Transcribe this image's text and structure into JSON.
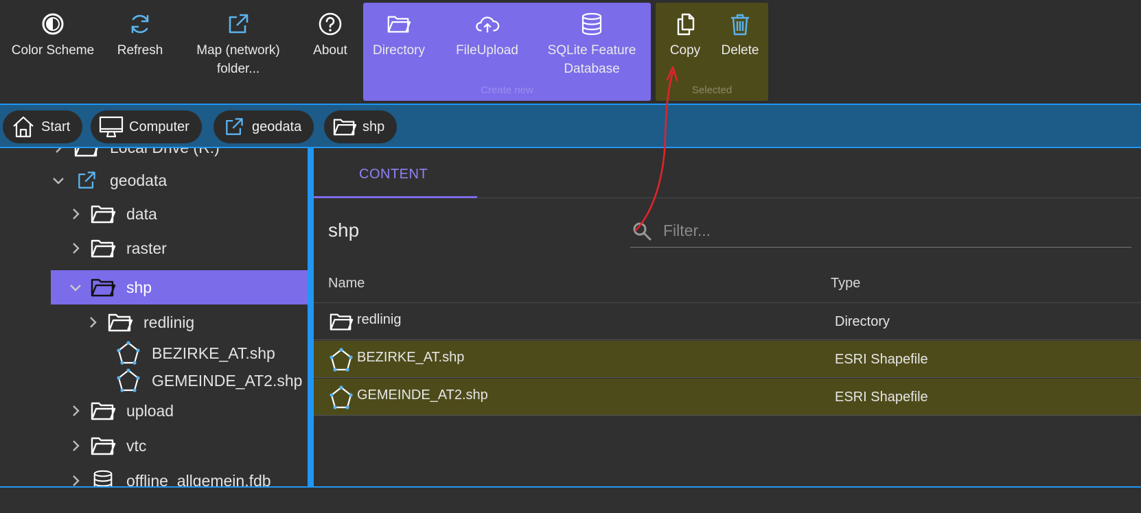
{
  "toolbar": {
    "buttons": [
      {
        "label": "Color Scheme",
        "icon": "contrast-icon"
      },
      {
        "label": "Refresh",
        "icon": "refresh-icon"
      },
      {
        "label": "Map (network) folder...",
        "icon": "external-link-icon"
      },
      {
        "label": "About",
        "icon": "help-icon"
      }
    ],
    "create_group": {
      "title": "Create new",
      "buttons": [
        {
          "label": "Directory",
          "icon": "folder-open-icon"
        },
        {
          "label": "FileUpload",
          "icon": "cloud-upload-icon"
        },
        {
          "label": "SQLite Feature Database",
          "icon": "database-icon"
        }
      ]
    },
    "selected_group": {
      "title": "Selected",
      "buttons": [
        {
          "label": "Copy",
          "icon": "copy-icon"
        },
        {
          "label": "Delete",
          "icon": "trash-icon"
        }
      ]
    }
  },
  "breadcrumbs": [
    {
      "label": "Start",
      "icon": "home-icon"
    },
    {
      "label": "Computer",
      "icon": "monitor-icon"
    },
    {
      "label": "geodata",
      "icon": "external-link-icon"
    },
    {
      "label": "shp",
      "icon": "folder-open-icon"
    }
  ],
  "tree": [
    {
      "label": "Local Drive (R:)",
      "icon": "folder-open-icon",
      "expanded": false
    },
    {
      "label": "geodata",
      "icon": "external-link-icon",
      "expanded": true
    },
    {
      "label": "data",
      "icon": "folder-open-icon",
      "expanded": false
    },
    {
      "label": "raster",
      "icon": "folder-open-icon",
      "expanded": false
    },
    {
      "label": "shp",
      "icon": "folder-open-icon",
      "expanded": true,
      "selected": true
    },
    {
      "label": "redlinig",
      "icon": "folder-open-icon",
      "expanded": false
    },
    {
      "label": "BEZIRKE_AT.shp",
      "icon": "polygon-icon"
    },
    {
      "label": "GEMEINDE_AT2.shp",
      "icon": "polygon-icon"
    },
    {
      "label": "upload",
      "icon": "folder-open-icon",
      "expanded": false
    },
    {
      "label": "vtc",
      "icon": "folder-open-icon",
      "expanded": false
    },
    {
      "label": "offline_allgemein.fdb",
      "icon": "database-icon",
      "expanded": false
    }
  ],
  "content": {
    "tab_label": "CONTENT",
    "folder_title": "shp",
    "filter_placeholder": "Filter...",
    "columns": {
      "name": "Name",
      "type": "Type"
    },
    "rows": [
      {
        "name": "redlinig",
        "type": "Directory",
        "icon": "folder-open-icon",
        "selected": false
      },
      {
        "name": "BEZIRKE_AT.shp",
        "type": "ESRI Shapefile",
        "icon": "polygon-icon",
        "selected": true
      },
      {
        "name": "GEMEINDE_AT2.shp",
        "type": "ESRI Shapefile",
        "icon": "polygon-icon",
        "selected": true
      }
    ]
  },
  "colors": {
    "accent_purple": "#7b6cea",
    "selection_olive": "#4e4b1b",
    "bar_blue": "#1d5b88",
    "border_blue": "#2196f3",
    "icon_blue": "#5ab4f0",
    "annotation_red": "#e0242a"
  }
}
